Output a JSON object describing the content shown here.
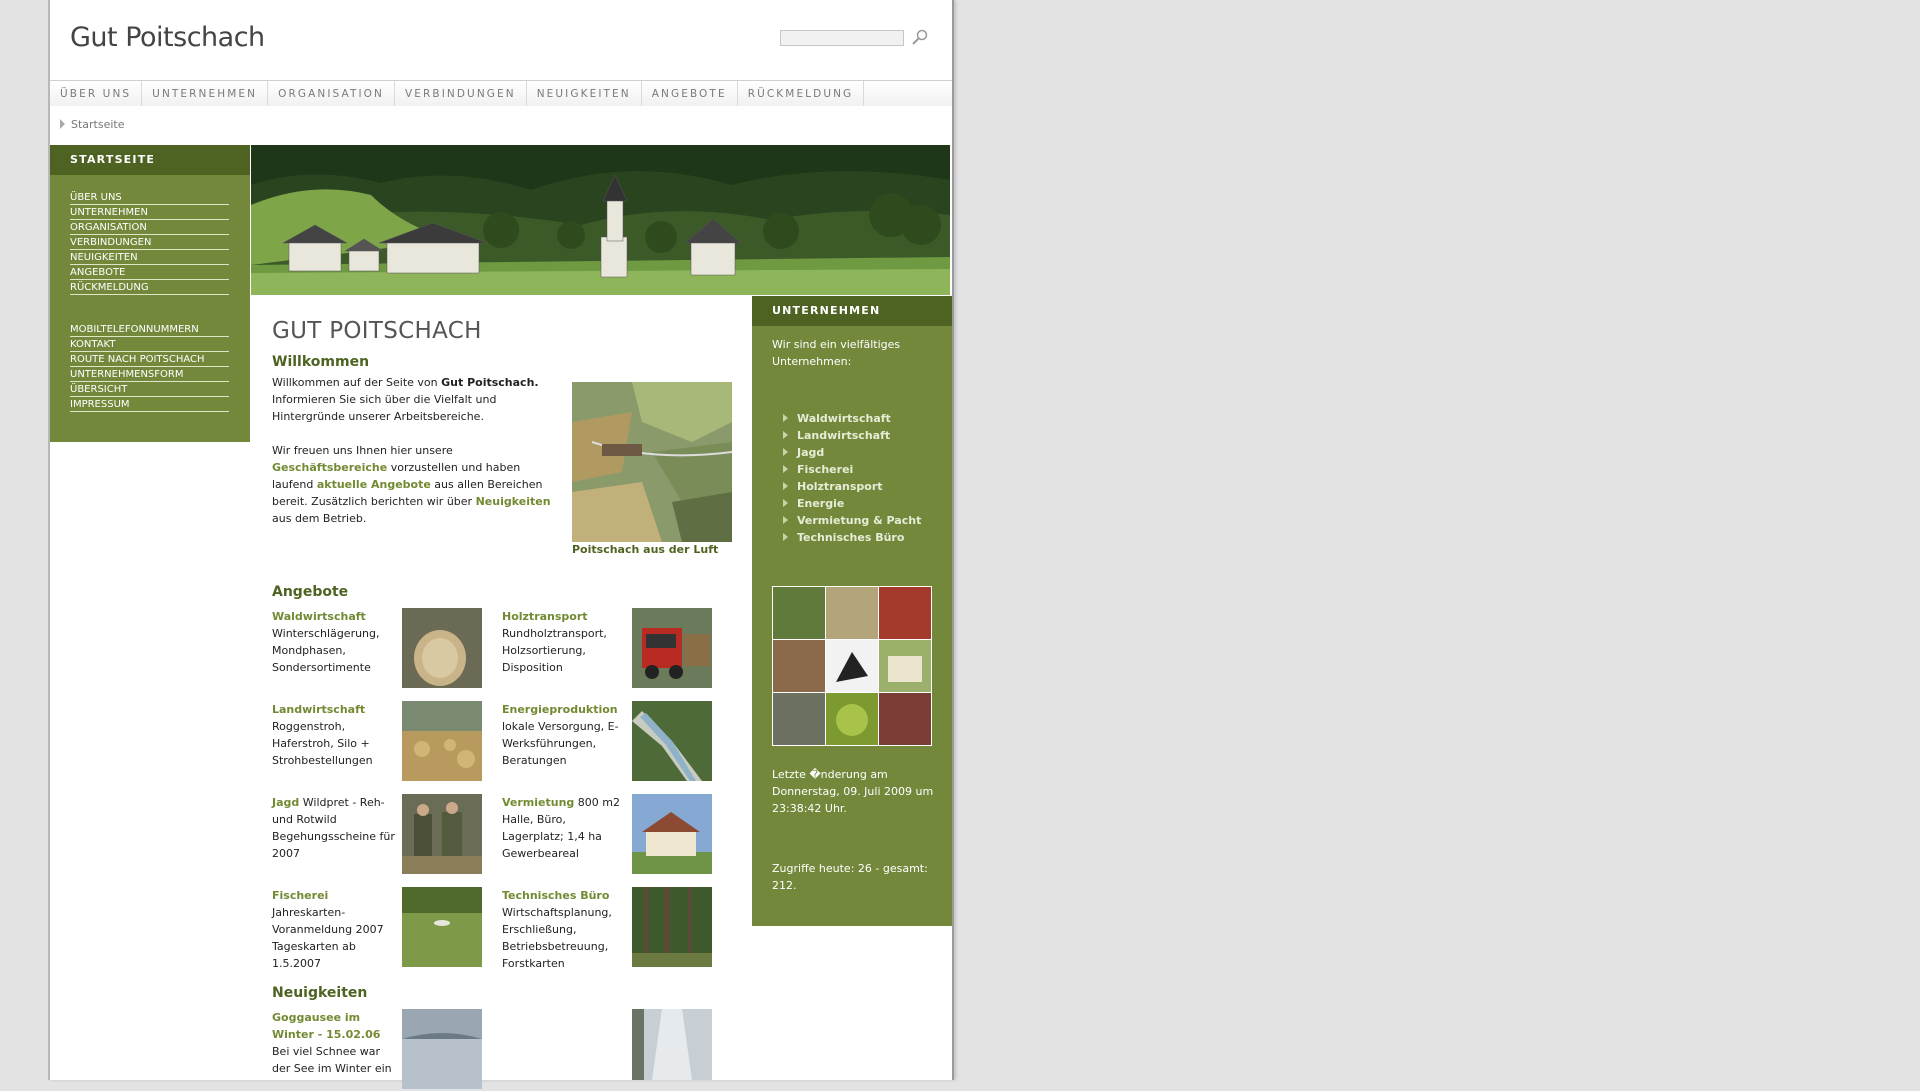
{
  "site": {
    "title": "Gut Poitschach"
  },
  "search": {
    "placeholder": ""
  },
  "topnav": [
    "ÜBER UNS",
    "UNTERNEHMEN",
    "ORGANISATION",
    "VERBINDUNGEN",
    "NEUIGKEITEN",
    "ANGEBOTE",
    "RÜCKMELDUNG"
  ],
  "breadcrumb": "Startseite",
  "leftnav": {
    "head": "STARTSEITE",
    "group1": [
      "ÜBER UNS",
      "UNTERNEHMEN",
      "ORGANISATION",
      "VERBINDUNGEN",
      "NEUIGKEITEN",
      "ANGEBOTE",
      "RÜCKMELDUNG"
    ],
    "group2": [
      "MOBILTELEFONNUMMERN",
      "KONTAKT",
      "ROUTE NACH POITSCHACH",
      "UNTERNEHMENSFORM",
      "ÜBERSICHT",
      "IMPRESSUM"
    ]
  },
  "main": {
    "title": "GUT POITSCHACH",
    "welcome_heading": "Willkommen",
    "welcome_p1_a": "Willkommen auf der Seite von ",
    "welcome_p1_b": "Gut Poitschach.",
    "welcome_p1_c": " Informieren Sie sich über die Vielfalt und Hintergründe unserer Arbeitsbereiche.",
    "welcome_p2_a": "Wir freuen uns Ihnen hier unsere ",
    "welcome_p2_link1": "Geschäftsbereiche",
    "welcome_p2_b": " vorzustellen und haben laufend ",
    "welcome_p2_link2": "aktuelle Angebote",
    "welcome_p2_c": " aus allen Bereichen bereit. Zusätzlich berichten wir über ",
    "welcome_p2_link3": "Neuigkeiten",
    "welcome_p2_d": " aus dem Betrieb.",
    "aerial_caption": "Poitschach aus der Luft",
    "offers_heading": "Angebote",
    "offers": [
      {
        "title": "Waldwirtschaft",
        "text": "Winterschlägerung, Mondphasen, Sondersortimente"
      },
      {
        "title": "Holztransport",
        "text": "Rundholztransport, Holzsortierung, Disposition"
      },
      {
        "title": "Landwirtschaft",
        "text": "Roggenstroh, Haferstroh, Silo + Strohbestellungen"
      },
      {
        "title": "Energieproduktion",
        "text": "lokale Versorgung, E-Werksführungen, Beratungen"
      },
      {
        "title": "Jagd",
        "text": " Wildpret - Reh- und Rotwild Begehungsscheine für 2007"
      },
      {
        "title": "Vermietung",
        "text": " 800 m2 Halle, Büro, Lagerplatz; 1,4 ha Gewerbeareal"
      },
      {
        "title": "Fischerei",
        "text": "Jahreskarten-Voranmeldung 2007 Tageskarten ab 1.5.2007"
      },
      {
        "title": "Technisches Büro",
        "text": "Wirtschaftsplanung, Erschließung, Betriebsbetreuung, Forstkarten"
      }
    ],
    "news_heading": "Neuigkeiten",
    "news": [
      {
        "title": "Goggausee im Winter - 15.02.06",
        "text": "Bei viel Schnee war der See im Winter ein"
      }
    ]
  },
  "right": {
    "head": "UNTERNEHMEN",
    "intro": "Wir sind ein vielfältiges Unternehmen:",
    "items": [
      "Waldwirtschaft",
      "Landwirtschaft",
      "Jagd",
      "Fischerei",
      "Holztransport",
      "Energie",
      "Vermietung & Pacht",
      "Technisches Büro"
    ],
    "updated": "Letzte �nderung am Donnerstag, 09. Juli 2009 um 23:38:42 Uhr.",
    "hits": "Zugriffe heute: 26 - gesamt: 212."
  },
  "colors": {
    "green": "#74883b",
    "dark_green": "#4e6321",
    "link_green": "#728a32"
  }
}
